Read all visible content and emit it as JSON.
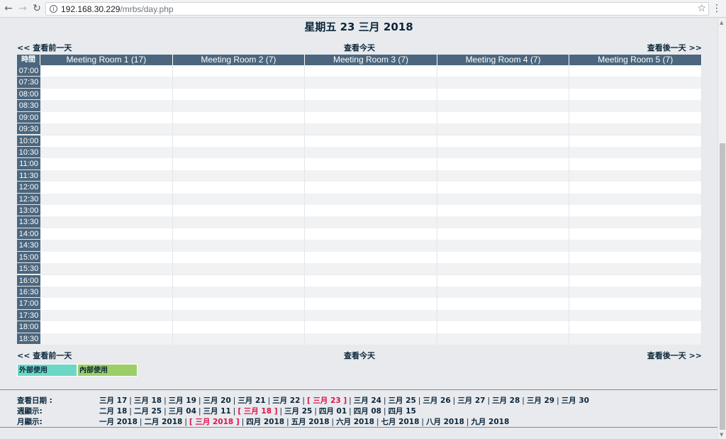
{
  "browser": {
    "url_host": "192.168.30.229",
    "url_path": "/mrbs/day.php"
  },
  "page": {
    "date_title": "星期五 23 三月 2018",
    "nav": {
      "prev": "<< 查看前一天",
      "today": "查看今天",
      "next": "查看後一天 >>"
    },
    "grid": {
      "time_header": "時間",
      "rooms": [
        "Meeting Room 1 (17)",
        "Meeting Room 2 (7)",
        "Meeting Room 3 (7)",
        "Meeting Room 4 (7)",
        "Meeting Room 5 (7)"
      ],
      "times": [
        "07:00",
        "07:30",
        "08:00",
        "08:30",
        "09:00",
        "09:30",
        "10:00",
        "10:30",
        "11:00",
        "11:30",
        "12:00",
        "12:30",
        "13:00",
        "13:30",
        "14:00",
        "14:30",
        "15:00",
        "15:30",
        "16:00",
        "16:30",
        "17:00",
        "17:30",
        "18:00",
        "18:30"
      ]
    },
    "legend": {
      "external": "外部使用",
      "internal": "內部使用",
      "colors": {
        "external": "#6dd7c5",
        "internal": "#9bce68"
      }
    },
    "footer": {
      "goto_date_label": "查看日期 :",
      "goto_date_items": [
        "三月 17",
        "三月 18",
        "三月 19",
        "三月 20",
        "三月 21",
        "三月 22",
        "[ 三月 23 ]",
        "三月 24",
        "三月 25",
        "三月 26",
        "三月 27",
        "三月 28",
        "三月 29",
        "三月 30"
      ],
      "goto_date_current": 6,
      "week_label": "週顯示:",
      "week_items": [
        "二月 18",
        "二月 25",
        "三月 04",
        "三月 11",
        "[ 三月 18 ]",
        "三月 25",
        "四月 01",
        "四月 08",
        "四月 15"
      ],
      "week_current": 4,
      "month_label": "月顯示:",
      "month_items": [
        "一月 2018",
        "二月 2018",
        "[ 三月 2018 ]",
        "四月 2018",
        "五月 2018",
        "六月 2018",
        "七月 2018",
        "八月 2018",
        "九月 2018"
      ],
      "month_current": 2
    }
  }
}
